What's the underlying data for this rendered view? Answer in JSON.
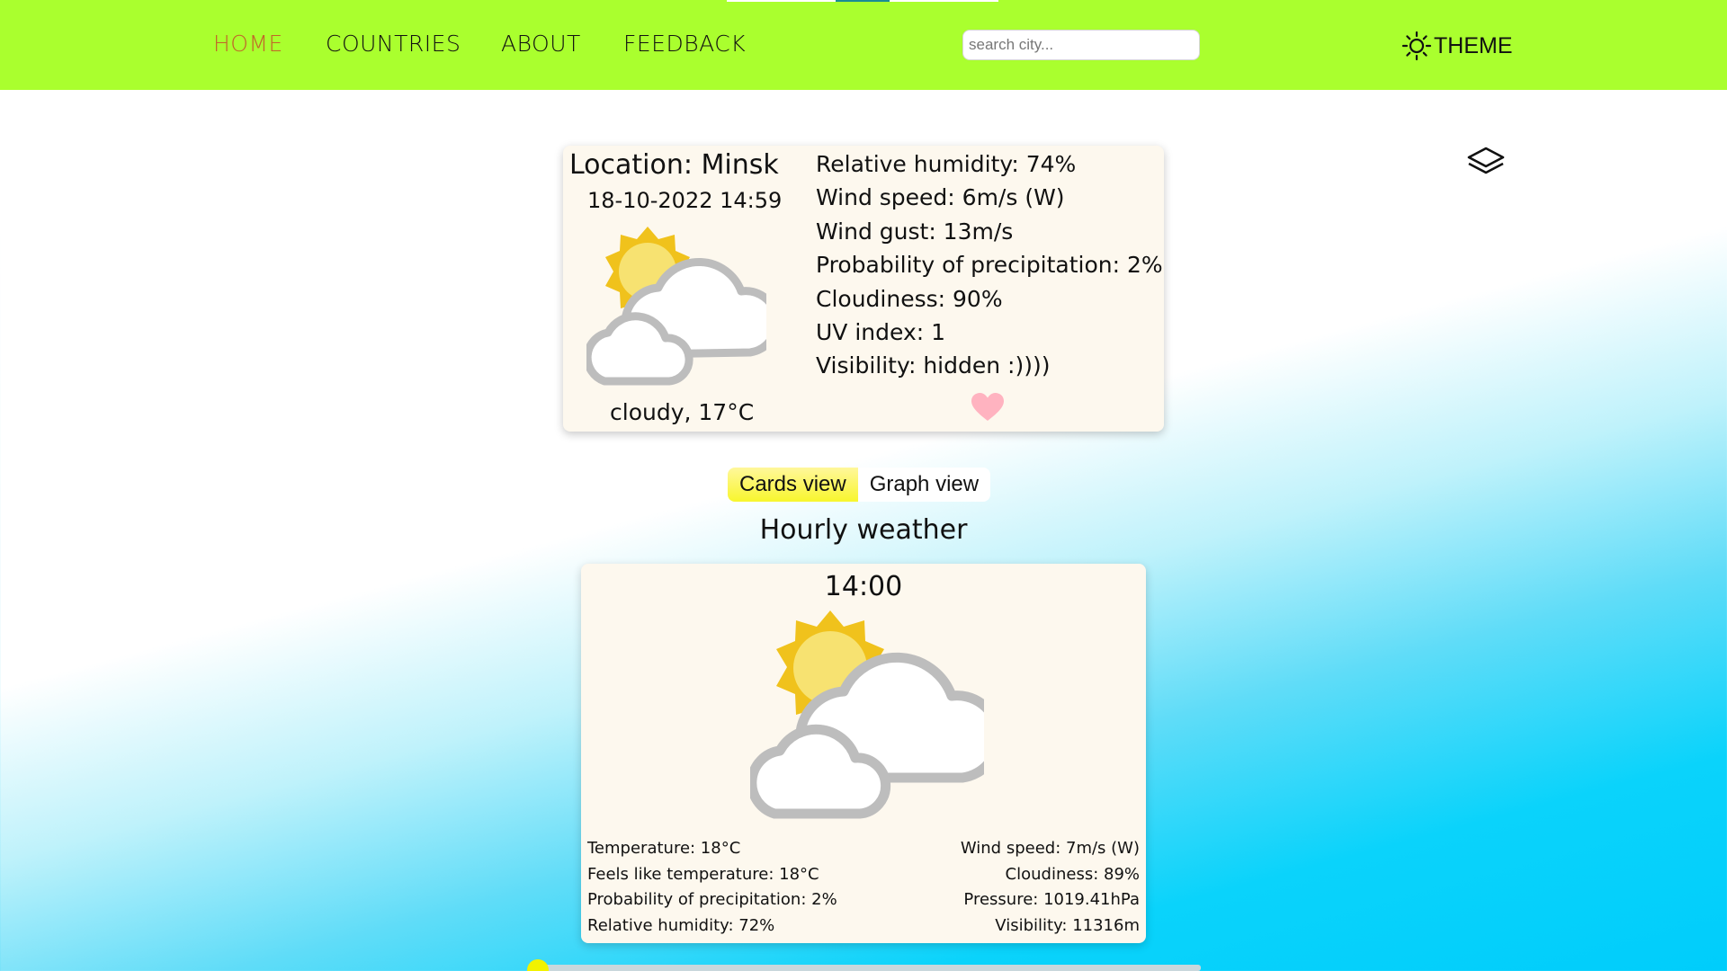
{
  "nav": {
    "links": [
      "HOME",
      "COUNTRIES",
      "ABOUT",
      "FEEDBACK"
    ],
    "active": "HOME",
    "search_placeholder": "search city...",
    "theme_label": "THEME",
    "colors": {
      "bar": "#aaff2e",
      "active_link": "#c2642a"
    }
  },
  "current": {
    "location": "Location: Minsk",
    "datetime": "18-10-2022 14:59",
    "description": "cloudy, 17°C",
    "icon": "partly-cloudy-icon",
    "details": [
      "Relative humidity: 74%",
      "Wind speed: 6m/s (W)",
      "Wind gust: 13m/s",
      "Probability of precipitation: 2%",
      "Cloudiness: 90%",
      "UV index: 1",
      "Visibility: hidden :))))"
    ],
    "favorite_icon": "heart-icon"
  },
  "view_switch": {
    "cards_label": "Cards view",
    "graph_label": "Graph view",
    "active": "Cards view"
  },
  "hourly": {
    "title": "Hourly weather",
    "card": {
      "time": "14:00",
      "icon": "partly-cloudy-icon",
      "left": [
        "Temperature: 18°C",
        "Feels like temperature: 18°C",
        "Probability of precipitation: 2%",
        "Relative humidity: 72%"
      ],
      "right": [
        "Wind speed: 7m/s (W)",
        "Cloudiness: 89%",
        "Pressure: 1019.41hPa",
        "Visibility: 11316m"
      ]
    },
    "slider_position": 0
  }
}
